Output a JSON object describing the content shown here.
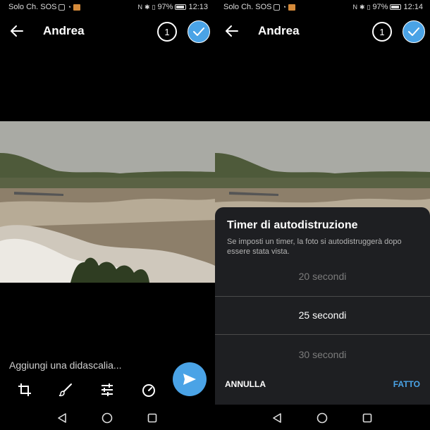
{
  "left": {
    "status": {
      "carrier": "Solo Ch. SOS",
      "battery": "97%",
      "time": "12:13"
    },
    "header": {
      "title": "Andrea",
      "count": "1"
    },
    "caption_placeholder": "Aggiungi una didascalia..."
  },
  "right": {
    "status": {
      "carrier": "Solo Ch. SOS",
      "battery": "97%",
      "time": "12:14"
    },
    "header": {
      "title": "Andrea",
      "count": "1"
    },
    "sheet": {
      "title": "Timer di autodistruzione",
      "description": "Se imposti un timer, la foto si autodistruggerà dopo essere stata vista.",
      "options": [
        "20 secondi",
        "25 secondi",
        "30 secondi"
      ],
      "selected": "25 secondi",
      "cancel": "ANNULLA",
      "done": "FATTO"
    }
  },
  "colors": {
    "accent": "#4aa3e6",
    "sheet_bg": "#1e1f22",
    "background": "#000000"
  },
  "icons": [
    "back-arrow-icon",
    "check-icon",
    "send-icon",
    "crop-icon",
    "brush-icon",
    "sliders-icon",
    "timer-icon",
    "nav-back-icon",
    "nav-home-icon",
    "nav-recents-icon"
  ]
}
